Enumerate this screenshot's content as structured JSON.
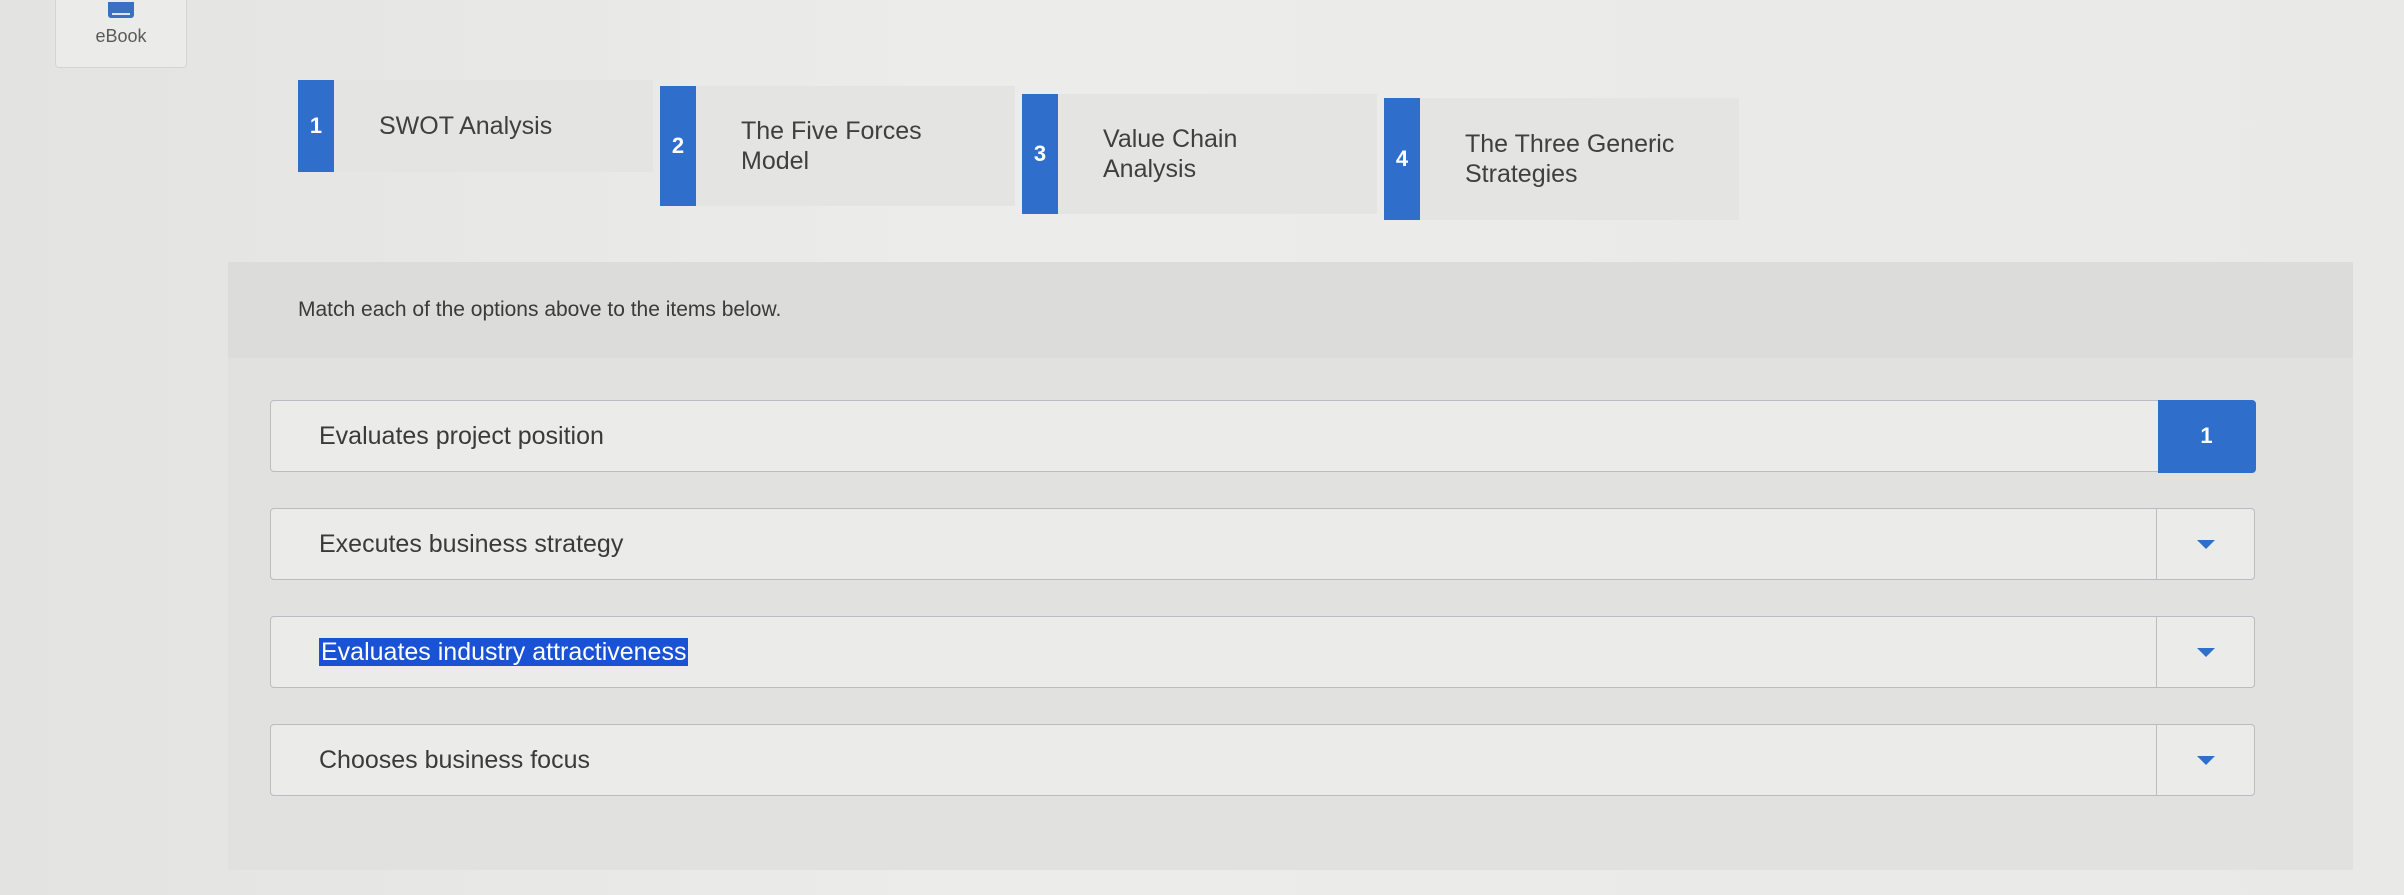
{
  "ebook": {
    "label": "eBook",
    "icon": "book-icon"
  },
  "options": [
    {
      "number": "1",
      "label": "SWOT Analysis"
    },
    {
      "number": "2",
      "label": "The Five Forces\nModel"
    },
    {
      "number": "3",
      "label": "Value Chain\nAnalysis"
    },
    {
      "number": "4",
      "label": "The Three Generic\nStrategies"
    }
  ],
  "instructions": "Match each of the options above to the items below.",
  "items": [
    {
      "text": "Evaluates project position",
      "selected_value": "1",
      "highlighted": false
    },
    {
      "text": "Executes business strategy",
      "selected_value": "",
      "highlighted": false
    },
    {
      "text": "Evaluates industry attractiveness",
      "selected_value": "",
      "highlighted": true
    },
    {
      "text": "Chooses business focus",
      "selected_value": "",
      "highlighted": false
    }
  ],
  "colors": {
    "accent": "#2f6fcb",
    "selection": "#1a52d6"
  }
}
